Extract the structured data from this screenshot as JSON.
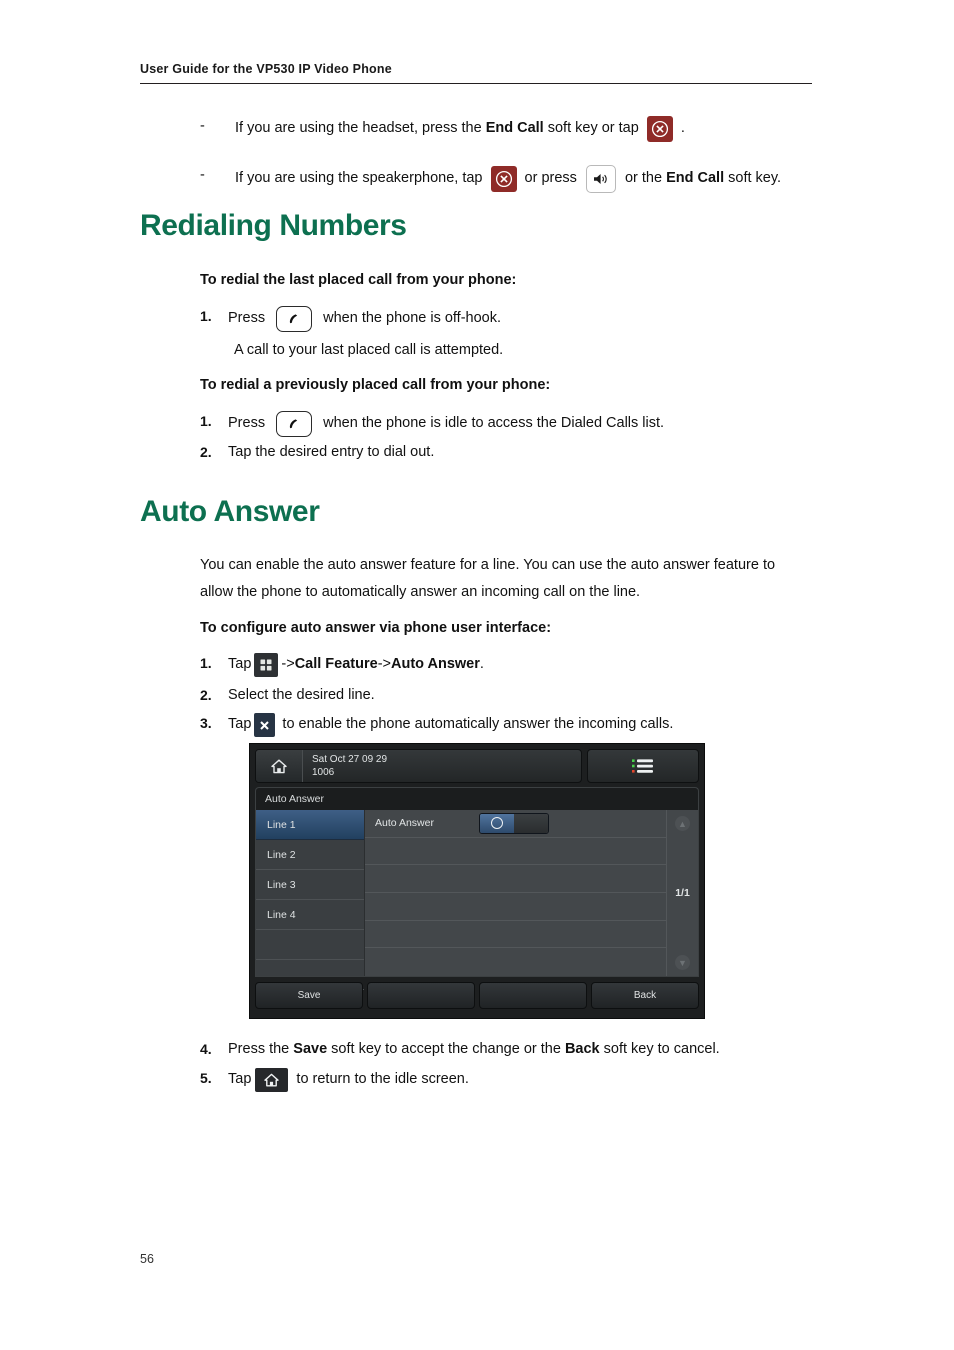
{
  "header": {
    "running_head": "User Guide for the VP530 IP Video Phone"
  },
  "bullets": [
    {
      "marker": "-",
      "parts": [
        {
          "type": "text",
          "value": "If you are using the headset, press the "
        },
        {
          "type": "bold",
          "value": "End Call"
        },
        {
          "type": "text",
          "value": " soft key or tap "
        },
        {
          "type": "icon",
          "value": "end-call-icon"
        },
        {
          "type": "text",
          "value": " ."
        }
      ]
    },
    {
      "marker": "-",
      "parts": [
        {
          "type": "text",
          "value": "If you are using the speakerphone, tap "
        },
        {
          "type": "icon",
          "value": "end-call-icon"
        },
        {
          "type": "text",
          "value": " or press "
        },
        {
          "type": "icon",
          "value": "speakerphone-icon"
        },
        {
          "type": "text",
          "value": " or the "
        },
        {
          "type": "bold",
          "value": "End Call"
        },
        {
          "type": "text",
          "value": " soft key."
        }
      ]
    }
  ],
  "sections": {
    "redialing": {
      "title": "Redialing Numbers",
      "sub1": "To redial the last placed call from your phone:",
      "step1_num": "1.",
      "step1_pre": "Press ",
      "step1_post": " when the phone is off-hook.",
      "step1_result": "A call to your last placed call is attempted.",
      "sub2": "To redial a previously placed call from your phone:",
      "step2_num": "1.",
      "step2_pre": "Press ",
      "step2_post": " when the phone is idle to access the Dialed Calls list.",
      "step3_num": "2.",
      "step3_text": "Tap the desired entry to dial out."
    },
    "auto_answer": {
      "title": "Auto Answer",
      "para": "You can enable the auto answer feature for a line. You can use the auto answer feature to allow the phone to automatically answer an incoming call on the line.",
      "sub1": "To configure auto answer via phone user interface:",
      "steps": {
        "s1_num": "1.",
        "s1_pre": "Tap",
        "s1_arrow1": "->",
        "s1_b1": "Call Feature",
        "s1_arrow2": "->",
        "s1_b2": "Auto Answer",
        "s1_end": ".",
        "s2_num": "2.",
        "s2_text": "Select the desired line.",
        "s3_num": "3.",
        "s3_pre": "Tap",
        "s3_post": " to enable the phone automatically answer the incoming calls.",
        "s4_num": "4.",
        "s4_p1": "Press the ",
        "s4_b1": "Save",
        "s4_p2": " soft key to accept the change or the ",
        "s4_b2": "Back",
        "s4_p3": " soft key to cancel.",
        "s5_num": "5.",
        "s5_pre": "Tap",
        "s5_post": " to return to the idle screen."
      }
    }
  },
  "phone_screen": {
    "status_line1": "Sat Oct 27 09 29",
    "status_line2": "1006",
    "home_icon": "home-icon",
    "menu_icon": "menu-list-icon",
    "title": "Auto Answer",
    "lines": [
      "Line 1",
      "Line 2",
      "Line 3",
      "Line 4",
      "",
      ""
    ],
    "selected_line_index": 0,
    "field_label": "Auto Answer",
    "field_toggle_state": "on",
    "page_indicator": "1/1",
    "scroll_up_icon": "arrow-up-icon",
    "scroll_down_icon": "arrow-down-icon",
    "softkeys": [
      "Save",
      "",
      "",
      "Back"
    ]
  },
  "footer": {
    "page_number": "56"
  },
  "colors": {
    "heading_green": "#0d7050",
    "end_call_red": "#8f2b28",
    "selected_row_blue": "#3f5f86",
    "screen_dark": "#1d1f20"
  }
}
